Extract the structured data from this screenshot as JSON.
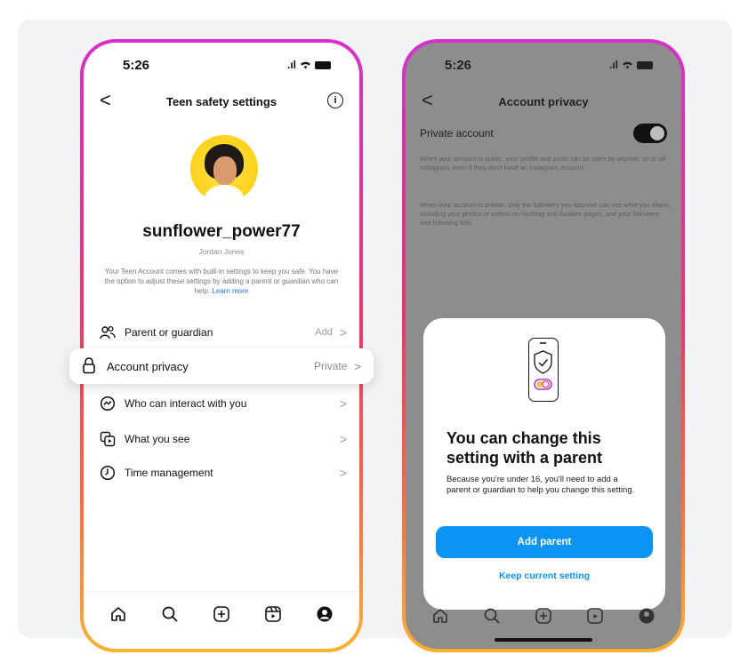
{
  "left_phone": {
    "time": "5:26",
    "signal_text": ".ıl",
    "nav_title": "Teen safety settings",
    "info_glyph": "i",
    "back_glyph": "<",
    "profile": {
      "username": "sunflower_power77",
      "real_name": "Jordan Jones",
      "blurb": "Your Teen Account comes with built-in settings to keep you safe. You have the option to adjust these settings by adding a parent or guardian who can help.",
      "blurb_link": "Learn more"
    },
    "settings": [
      {
        "label": "Parent or guardian",
        "value": "Add",
        "icon": "people-icon"
      },
      {
        "label": "Account privacy",
        "value": "Private",
        "icon": "lock-icon"
      },
      {
        "label": "Who can interact with you",
        "value": "",
        "icon": "chat-icon"
      },
      {
        "label": "What you see",
        "value": "",
        "icon": "media-icon"
      },
      {
        "label": "Time management",
        "value": "",
        "icon": "clock-icon"
      }
    ],
    "chevron": ">",
    "tabs": [
      "home-icon",
      "search-icon",
      "create-icon",
      "reels-icon",
      "profile-icon"
    ]
  },
  "right_phone": {
    "time": "5:26",
    "signal_text": ".ıl",
    "back_glyph": "<",
    "nav_title": "Account privacy",
    "private_label": "Private account",
    "desc_public": "When your account is public, your profile and posts can be seen by anyone, on or off Instagram, even if they don't have an Instagram account.",
    "desc_private": "When your account is private, only the followers you approve can see what you share, including your photos or videos on hashtag and location pages, and your followers and following lists.",
    "sheet": {
      "title": "You can change this setting with a parent",
      "body": "Because you're under 16, you'll need to add a parent or guardian to help you change this setting.",
      "primary": "Add parent",
      "secondary": "Keep current setting"
    }
  },
  "colors": {
    "accent_blue": "#0a95f6",
    "link_blue": "#1877f2",
    "frame_gradient_top": "#d82fd0",
    "frame_gradient_bottom": "#ffb02e"
  }
}
